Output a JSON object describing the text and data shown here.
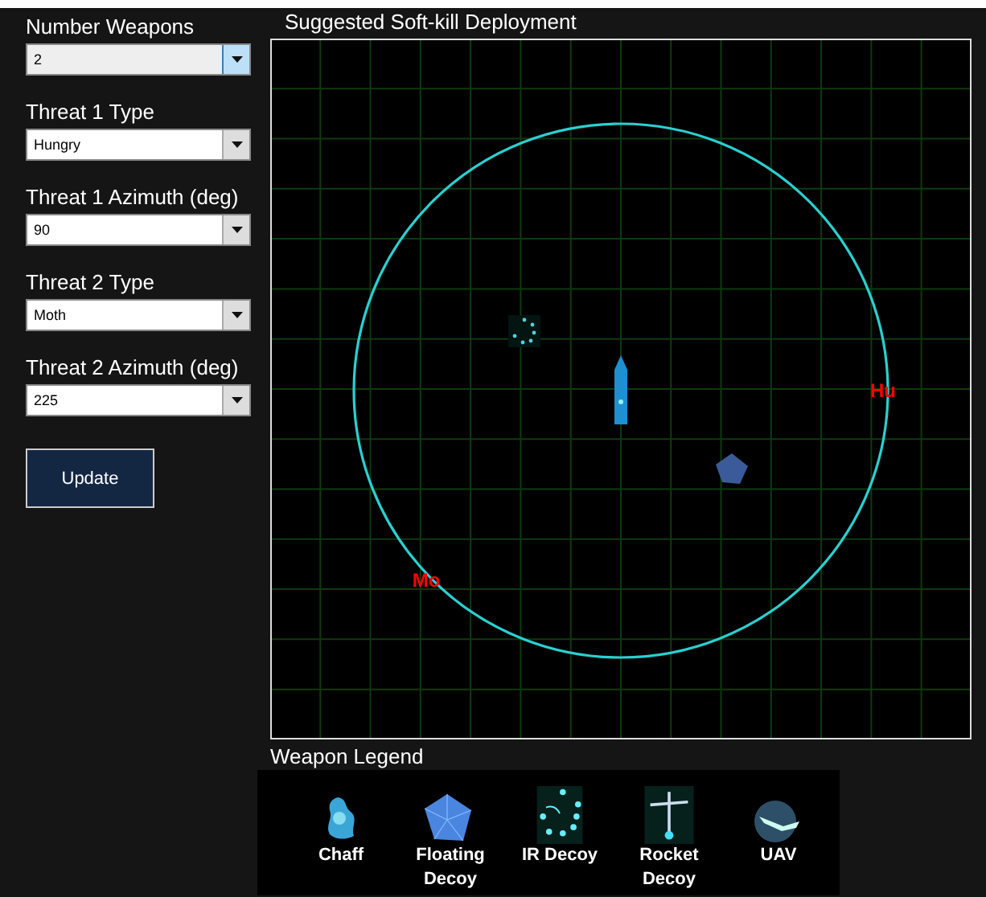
{
  "controls": [
    {
      "label": "Number Weapons",
      "value": "2",
      "focused": true
    },
    {
      "label": "Threat 1 Type",
      "value": "Hungry",
      "focused": false
    },
    {
      "label": "Threat 1 Azimuth (deg)",
      "value": "90",
      "focused": false
    },
    {
      "label": "Threat 2 Type",
      "value": "Moth",
      "focused": false
    },
    {
      "label": "Threat 2 Azimuth (deg)",
      "value": "225",
      "focused": false
    }
  ],
  "update_button": "Update",
  "plot": {
    "title": "Suggested Soft-kill Deployment",
    "threats": [
      {
        "label": "Hu"
      },
      {
        "label": "Mo"
      }
    ],
    "objects": [
      {
        "kind": "ship"
      },
      {
        "kind": "ir_decoy"
      },
      {
        "kind": "floating_decoy"
      }
    ]
  },
  "legend": {
    "title": "Weapon Legend",
    "items": [
      {
        "kind": "chaff",
        "label": "Chaff"
      },
      {
        "kind": "floating_decoy",
        "label": "Floating Decoy"
      },
      {
        "kind": "ir_decoy",
        "label": "IR Decoy"
      },
      {
        "kind": "rocket_decoy",
        "label": "Rocket Decoy"
      },
      {
        "kind": "uav",
        "label": "UAV"
      }
    ]
  }
}
